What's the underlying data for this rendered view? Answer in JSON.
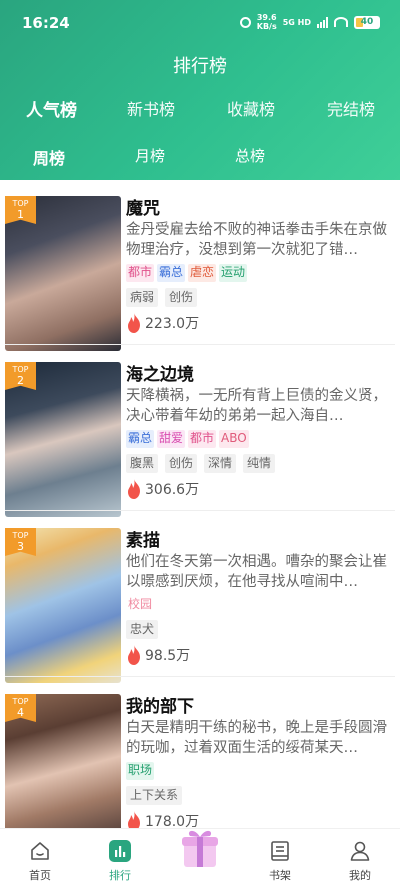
{
  "status_bar": {
    "time": "16:24",
    "net_speed_value": "39.6",
    "net_speed_unit": "KB/s",
    "network_label": "5G HD",
    "battery": "40"
  },
  "page_title": "排行榜",
  "main_tabs": [
    {
      "label": "人气榜",
      "active": true
    },
    {
      "label": "新书榜",
      "active": false
    },
    {
      "label": "收藏榜",
      "active": false
    },
    {
      "label": "完结榜",
      "active": false
    }
  ],
  "sub_tabs": [
    {
      "label": "周榜",
      "active": true
    },
    {
      "label": "月榜",
      "active": false
    },
    {
      "label": "总榜",
      "active": false
    }
  ],
  "items": [
    {
      "rank_label": "TOP",
      "rank": "1",
      "title": "魔咒",
      "description": "金丹受雇去给不败的神话拳击手朱在京做物理治疗，没想到第一次就犯了错…",
      "genres": [
        {
          "label": "都市",
          "color": "#e0508a",
          "bg": "#fde8f0"
        },
        {
          "label": "霸总",
          "color": "#3a6fd8",
          "bg": "#e6eefc"
        },
        {
          "label": "虐恋",
          "color": "#e05a3a",
          "bg": "#fde9e4"
        },
        {
          "label": "运动",
          "color": "#25a06f",
          "bg": "#e3f6ee"
        }
      ],
      "tags": [
        "病弱",
        "创伤"
      ],
      "heat": "223.0万"
    },
    {
      "rank_label": "TOP",
      "rank": "2",
      "title": "海之边境",
      "description": "天降横祸，一无所有背上巨债的金义贤，决心带着年幼的弟弟一起入海自…",
      "genres": [
        {
          "label": "霸总",
          "color": "#3a6fd8",
          "bg": "#e6eefc"
        },
        {
          "label": "甜爱",
          "color": "#d94db0",
          "bg": "#fbe6f5"
        },
        {
          "label": "都市",
          "color": "#e0508a",
          "bg": "#fde8f0"
        },
        {
          "label": "ABO",
          "color": "#e05a7a",
          "bg": "#fde8ee"
        }
      ],
      "tags": [
        "腹黑",
        "创伤",
        "深情",
        "纯情"
      ],
      "heat": "306.6万"
    },
    {
      "rank_label": "TOP",
      "rank": "3",
      "title": "素描",
      "description": "他们在冬天第一次相遇。嘈杂的聚会让崔以暻感到厌烦，在他寻找从喧闹中…",
      "genres": [
        {
          "label": "校园",
          "color": "#f08aa0",
          "bg": "#ffffff"
        }
      ],
      "tags": [
        "忠犬"
      ],
      "heat": "98.5万"
    },
    {
      "rank_label": "TOP",
      "rank": "4",
      "title": "我的部下",
      "description": "白天是精明干练的秘书，晚上是手段圆滑的玩咖，过着双面生活的绥荷某天…",
      "genres": [
        {
          "label": "职场",
          "color": "#25a06f",
          "bg": "#e3f6ee"
        }
      ],
      "tags": [
        "上下关系"
      ],
      "heat": "178.0万"
    }
  ],
  "bottom_nav": [
    {
      "label": "首页",
      "icon": "home-icon",
      "active": false
    },
    {
      "label": "排行",
      "icon": "ranking-icon",
      "active": true
    },
    {
      "label": "",
      "icon": "gift-icon",
      "active": false
    },
    {
      "label": "书架",
      "icon": "bookshelf-icon",
      "active": false
    },
    {
      "label": "我的",
      "icon": "profile-icon",
      "active": false
    }
  ],
  "colors": {
    "accent": "#2aa57f",
    "badge": "#f29b2a",
    "flame": "#f2544a"
  }
}
